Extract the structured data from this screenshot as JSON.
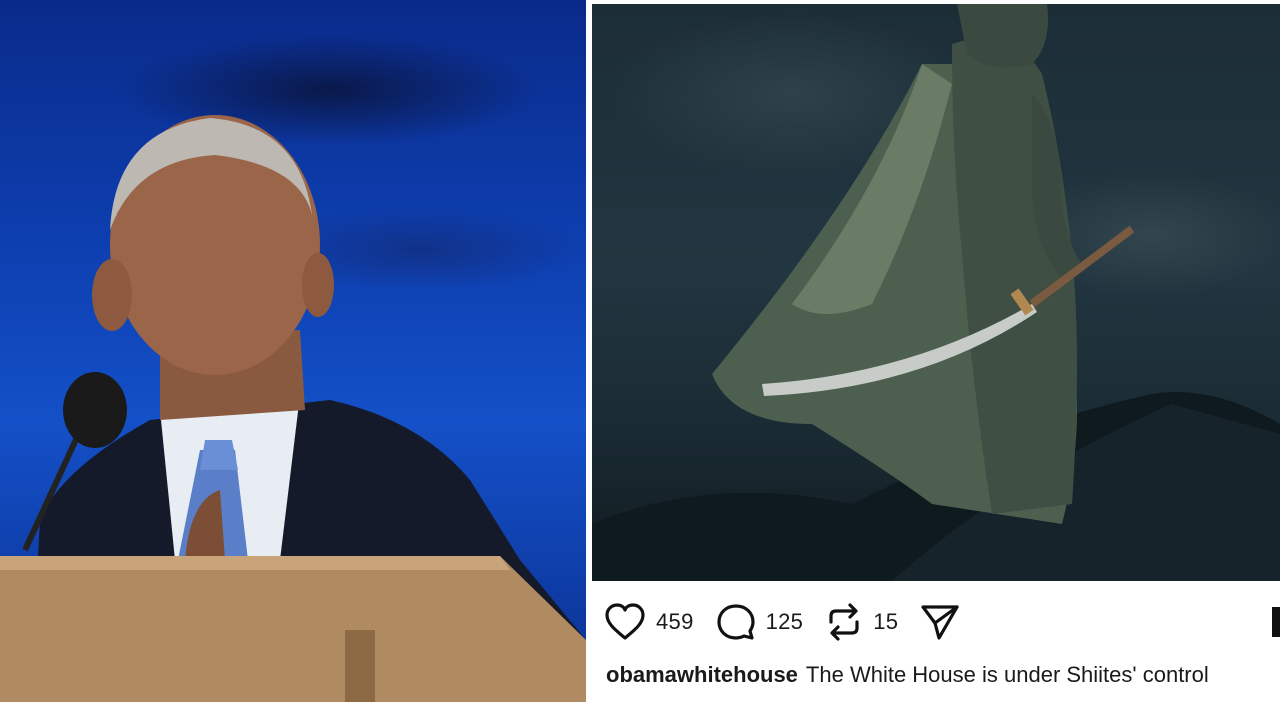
{
  "left_photo": {
    "alt": "Man speaking at a podium with a microphone, blue background"
  },
  "right_photo": {
    "alt": "Painting of a cloaked warrior holding a curved sword on a dark rocky hill"
  },
  "post": {
    "actions": {
      "like_icon": "heart-icon",
      "like_count": "459",
      "comment_icon": "comment-icon",
      "comment_count": "125",
      "repost_icon": "repost-icon",
      "repost_count": "15",
      "share_icon": "share-icon"
    },
    "caption": {
      "username": "obamawhitehouse",
      "text": "The White House is under Shiites' control"
    }
  }
}
